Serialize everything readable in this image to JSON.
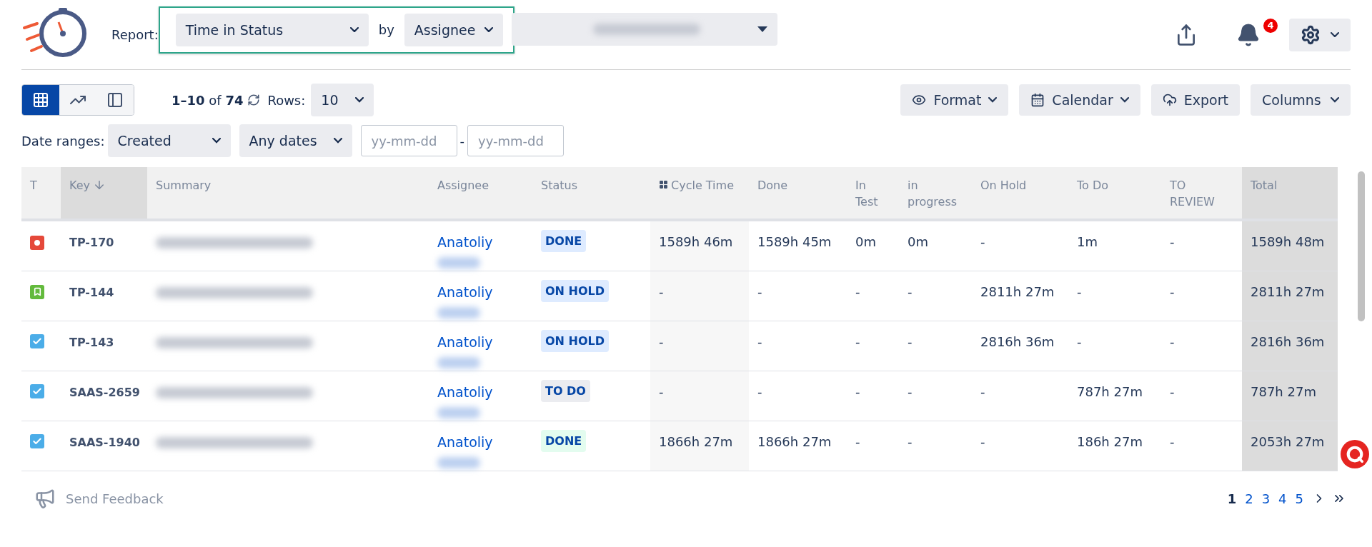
{
  "header": {
    "report_label": "Report:",
    "report_select": "Time in Status",
    "by_label": "by",
    "group_select": "Assignee",
    "notification_count": "4"
  },
  "toolbar": {
    "views": [
      {
        "kind": "grid",
        "selected": true
      },
      {
        "kind": "chart",
        "selected": false
      },
      {
        "kind": "layout",
        "selected": false
      }
    ],
    "range": "**1–10** of **74**",
    "rows_label": "Rows:",
    "rows_value": "10",
    "buttons": [
      {
        "kind": "format",
        "label": "Format"
      },
      {
        "kind": "calendar",
        "label": "Calendar"
      },
      {
        "kind": "export",
        "label": "Export"
      },
      {
        "kind": "columns",
        "label": "Columns"
      }
    ]
  },
  "date_filter": {
    "label": "Date ranges:",
    "field": "Created",
    "period": "Any dates",
    "from_placeholder": "yy-mm-dd",
    "separator": "-",
    "to_placeholder": "yy-mm-dd"
  },
  "table": {
    "columns": [
      {
        "label": "T",
        "kind": "plain"
      },
      {
        "label": "Key",
        "kind": "sorted"
      },
      {
        "label": "Summary",
        "kind": "plain"
      },
      {
        "label": "Assignee",
        "kind": "plain"
      },
      {
        "label": "Status",
        "kind": "plain"
      },
      {
        "label": "Cycle Time",
        "kind": "calculated"
      },
      {
        "label": "Done",
        "kind": "plain"
      },
      {
        "label": "In Test",
        "kind": "plain"
      },
      {
        "label": "in progress",
        "kind": "plain"
      },
      {
        "label": "On Hold",
        "kind": "plain"
      },
      {
        "label": "To Do",
        "kind": "plain"
      },
      {
        "label": "TO REVIEW",
        "kind": "plain"
      },
      {
        "label": "Total",
        "kind": "total"
      }
    ],
    "rows": [
      {
        "kind": "bug",
        "key": "TP-170",
        "assignee": "Anatoliy",
        "status": {
          "label": "DONE",
          "color": "#deebff"
        },
        "times": [
          "1589h 46m",
          "1589h 45m",
          "0m",
          "0m",
          "-",
          "1m",
          "-",
          "1589h 48m"
        ]
      },
      {
        "kind": "story",
        "key": "TP-144",
        "assignee": "Anatoliy",
        "status": {
          "label": "ON HOLD",
          "color": "#deebff"
        },
        "times": [
          "-",
          "-",
          "-",
          "-",
          "2811h 27m",
          "-",
          "-",
          "2811h 27m"
        ]
      },
      {
        "kind": "task",
        "key": "TP-143",
        "assignee": "Anatoliy",
        "status": {
          "label": "ON HOLD",
          "color": "#deebff"
        },
        "times": [
          "-",
          "-",
          "-",
          "-",
          "2816h 36m",
          "-",
          "-",
          "2816h 36m"
        ]
      },
      {
        "kind": "task",
        "key": "SAAS-2659",
        "assignee": "Anatoliy",
        "status": {
          "label": "TO DO",
          "color": "#ebecf0"
        },
        "times": [
          "-",
          "-",
          "-",
          "-",
          "-",
          "787h 27m",
          "-",
          "787h 27m"
        ]
      },
      {
        "kind": "task",
        "key": "SAAS-1940",
        "assignee": "Anatoliy",
        "status": {
          "label": "DONE",
          "color": "#e3fcef"
        },
        "times": [
          "1866h 27m",
          "1866h 27m",
          "-",
          "-",
          "-",
          "186h 27m",
          "-",
          "2053h 27m"
        ]
      }
    ]
  },
  "footer": {
    "feedback": "Send Feedback",
    "pages": [
      {
        "label": "1",
        "selected": true
      },
      {
        "label": "2",
        "selected": false
      },
      {
        "label": "3",
        "selected": false
      },
      {
        "label": "4",
        "selected": false
      },
      {
        "label": "5",
        "selected": false
      }
    ]
  }
}
